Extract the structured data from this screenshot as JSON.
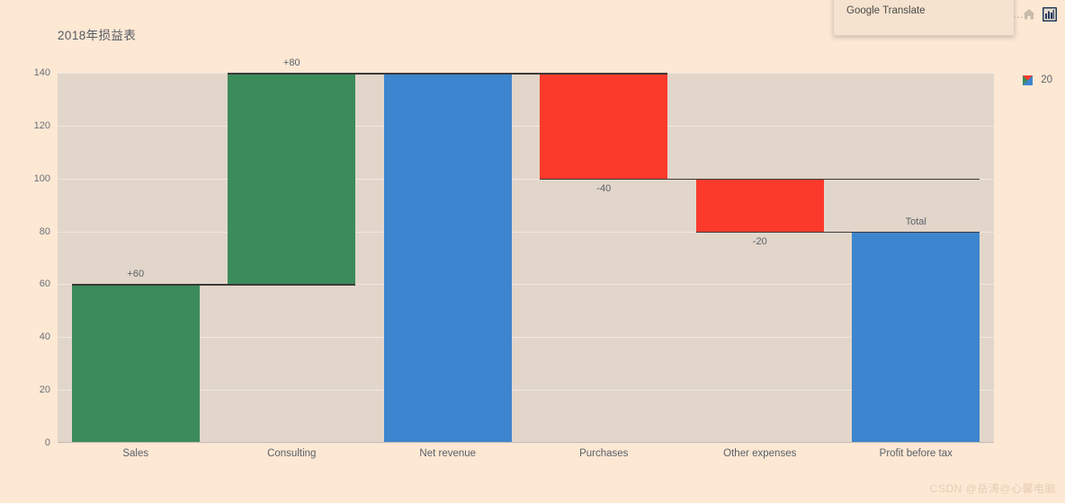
{
  "browser": {
    "translate_popup": {
      "label": "Google Translate"
    },
    "icons": {
      "partial": "…",
      "home": "home-icon",
      "extension": "chart-extension-icon"
    }
  },
  "chart": {
    "title": "2018年损益表",
    "legend": {
      "label": "20",
      "swatch": "waterfall-swatch-icon"
    }
  },
  "watermark": "CSDN @岳涛@心馨电脑",
  "colors": {
    "page_background": "#fde8d4",
    "plot_background": "#e2d6ca",
    "gridline": "#f0e7dd",
    "increase": "#3c8b5b",
    "decrease": "#fb3a2c",
    "total": "#3d85ce",
    "connector": "#3a3a3a",
    "text": "#5a5f68"
  },
  "chart_data": {
    "type": "bar",
    "chart_subtype": "waterfall",
    "title": "2018年损益表",
    "xlabel": "",
    "ylabel": "",
    "ylim": [
      0,
      140
    ],
    "grid": true,
    "legend_position": "top-right",
    "legend_entries": [
      "20"
    ],
    "yticks": [
      0,
      20,
      40,
      60,
      80,
      100,
      120,
      140
    ],
    "categories": [
      "Sales",
      "Consulting",
      "Net revenue",
      "Purchases",
      "Other expenses",
      "Profit before tax"
    ],
    "labels": [
      "+60",
      "+80",
      "",
      "-40",
      "-20",
      "Total"
    ],
    "measures": [
      "relative",
      "relative",
      "total",
      "relative",
      "relative",
      "total"
    ],
    "values": [
      60,
      80,
      140,
      -40,
      -20,
      80
    ],
    "bar_base": [
      0,
      60,
      0,
      100,
      80,
      0
    ],
    "bar_top": [
      60,
      140,
      140,
      140,
      100,
      80
    ],
    "bar_colors": [
      "#3c8b5b",
      "#3c8b5b",
      "#3d85ce",
      "#fb3a2c",
      "#fb3a2c",
      "#3d85ce"
    ],
    "label_positions": [
      "above",
      "above",
      "none",
      "below",
      "below",
      "above"
    ]
  }
}
